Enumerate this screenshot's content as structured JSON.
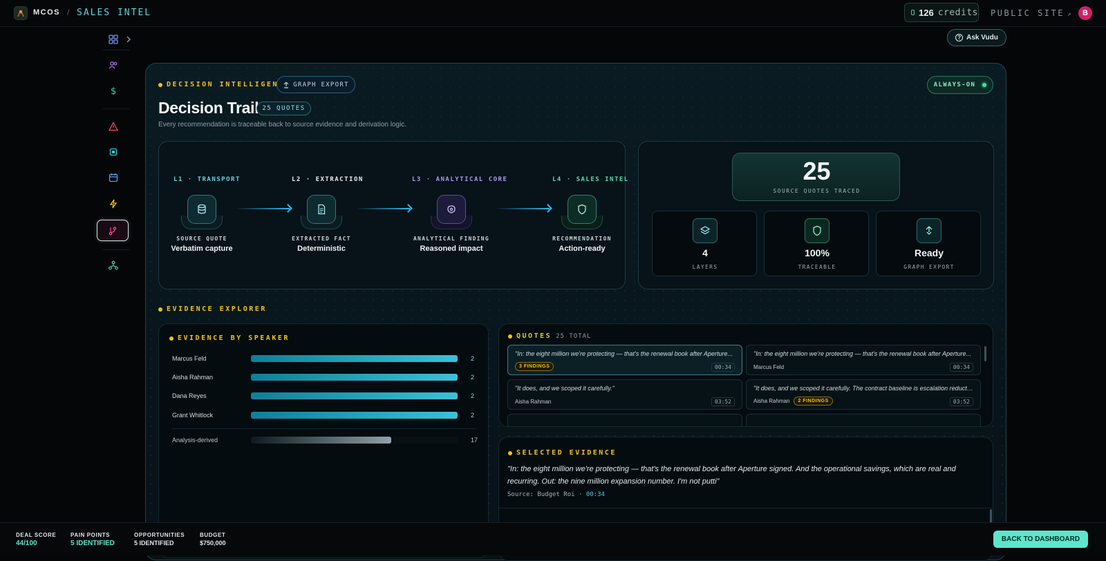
{
  "topbar": {
    "app_name": "MCOS",
    "separator": "/",
    "section": "SALES INTEL",
    "credits_value": "126",
    "credits_label": "credits",
    "public_site": "PUBLIC SITE",
    "public_site_arrow": "↗",
    "avatar_initial": "B"
  },
  "sidebar": {
    "items": [
      {
        "icon": "grid-icon",
        "color": "#7d8cf0"
      },
      {
        "icon": "users-icon",
        "color": "#b06de8"
      },
      {
        "icon": "dollar-icon",
        "color": "#3fd6a0"
      },
      {
        "icon": "alert-triangle-icon",
        "color": "#ef4f5a"
      },
      {
        "icon": "chip-icon",
        "color": "#33c6d6"
      },
      {
        "icon": "calendar-icon",
        "color": "#4fa0f0"
      },
      {
        "icon": "bolt-icon",
        "color": "#f0c21a"
      },
      {
        "icon": "git-branch-icon",
        "color": "#e84a8a",
        "active": true
      },
      {
        "icon": "network-icon",
        "color": "#3fd6a0"
      }
    ],
    "expand_icon": "chevron-right-icon"
  },
  "ask_vudu": "Ask Vudu",
  "header": {
    "kicker": "DECISION INTELLIGENCE",
    "graph_export": "GRAPH EXPORT",
    "always_on": "ALWAYS-ON",
    "title": "Decision Trail",
    "quotes_badge": "25 QUOTES",
    "description": "Every recommendation is traceable back to source evidence and derivation logic."
  },
  "pipeline": {
    "stages": [
      {
        "label": "L1 · TRANSPORT",
        "label_color": "#5fd4e0",
        "icon": "database-icon",
        "caption": "SOURCE QUOTE",
        "sub": "Verbatim capture"
      },
      {
        "label": "L2 · EXTRACTION",
        "label_color": "#e8eef0",
        "icon": "document-icon",
        "caption": "EXTRACTED FACT",
        "sub": "Deterministic"
      },
      {
        "label": "L3 · ANALYTICAL CORE",
        "label_color": "#a89af0",
        "icon": "brain-icon",
        "caption": "ANALYTICAL FINDING",
        "sub": "Reasoned impact"
      },
      {
        "label": "L4 · SALES INTEL",
        "label_color": "#4fe0b0",
        "icon": "shield-icon",
        "caption": "RECOMMENDATION",
        "sub": "Action-ready"
      }
    ]
  },
  "stats": {
    "big_value": "25",
    "big_label": "SOURCE QUOTES TRACED",
    "minis": [
      {
        "icon": "layers-icon",
        "value": "4",
        "label": "LAYERS"
      },
      {
        "icon": "shield-check-icon",
        "value": "100%",
        "label": "TRACEABLE"
      },
      {
        "icon": "export-icon",
        "value": "Ready",
        "label": "GRAPH EXPORT"
      }
    ]
  },
  "evidence_explorer": {
    "kicker": "EVIDENCE EXPLORER",
    "speakers_title": "EVIDENCE BY SPEAKER",
    "speakers": [
      {
        "name": "Marcus Feld",
        "count": "2",
        "fraction": 1.0
      },
      {
        "name": "Aisha Rahman",
        "count": "2",
        "fraction": 1.0
      },
      {
        "name": "Dana Reyes",
        "count": "2",
        "fraction": 1.0
      },
      {
        "name": "Grant Whitlock",
        "count": "2",
        "fraction": 1.0
      }
    ],
    "derived": {
      "name": "Analysis-derived",
      "count": "17",
      "fraction": 0.68
    }
  },
  "quotes": {
    "title": "QUOTES",
    "total": "25 TOTAL",
    "items": [
      {
        "text": "\"In: the eight million we're protecting — that's the renewal book after Aperture...",
        "speaker": "",
        "findings": "3 FINDINGS",
        "time": "00:34",
        "selected": true
      },
      {
        "text": "\"In: the eight million we're protecting — that's the renewal book after Aperture...",
        "speaker": "Marcus Feld",
        "findings": "",
        "time": "00:34"
      },
      {
        "text": "\"It does, and we scoped it carefully.\"",
        "speaker": "Aisha Rahman",
        "findings": "",
        "time": "03:52"
      },
      {
        "text": "\"It does, and we scoped it carefully. The contract baseline is escalation reductio...",
        "speaker": "Aisha Rahman",
        "findings": "2 FINDINGS",
        "time": "03:52"
      }
    ]
  },
  "selected_evidence": {
    "title": "SELECTED EVIDENCE",
    "quote": "\"In: the eight million we're protecting — that's the renewal book after Aperture signed. And the operational savings, which are real and recurring. Out: the nine million expansion number. I'm not putti\"",
    "source_label": "Source: Budget Roi",
    "source_sep": "·",
    "source_time": "00:34"
  },
  "bottombar": {
    "deal_score_label": "DEAL SCORE",
    "deal_score": "44/100",
    "pain_points_label": "PAIN POINTS",
    "pain_points": "5 IDENTIFIED",
    "opportunities_label": "OPPORTUNITIES",
    "opportunities": "5 IDENTIFIED",
    "budget_label": "BUDGET",
    "budget": "$750,000",
    "back_button": "BACK TO DASHBOARD"
  },
  "colors": {
    "accent": "#5fd4e0",
    "gold": "#f0c21a",
    "mint": "#5ee6cc",
    "score": "#5ee6cc"
  }
}
